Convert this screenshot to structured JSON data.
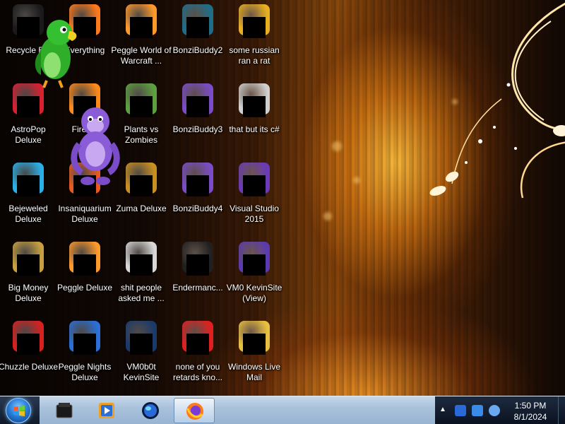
{
  "desktop": {
    "icons": [
      {
        "label": "Recycle Bin",
        "icon": "recycle-bin-icon",
        "color": "#1a1a1a"
      },
      {
        "label": "Everything",
        "icon": "everything-search-icon",
        "color": "#ff7a1a"
      },
      {
        "label": "Peggle World of Warcraft ...",
        "icon": "peggle-wow-icon",
        "color": "#ff9a2a"
      },
      {
        "label": "BonziBuddy2",
        "icon": "bonzibuddy-icon",
        "color": "#1e6e8a"
      },
      {
        "label": "some russian ran a rat",
        "icon": "document-icon",
        "color": "#e8b020"
      },
      {
        "label": "AstroPop Deluxe",
        "icon": "astropop-icon",
        "color": "#d82030"
      },
      {
        "label": "Firefox",
        "icon": "firefox-icon",
        "color": "#ff8a1a"
      },
      {
        "label": "Plants vs Zombies",
        "icon": "plants-vs-zombies-icon",
        "color": "#5ea040"
      },
      {
        "label": "BonziBuddy3",
        "icon": "bonzibuddy-icon",
        "color": "#7a4cc8"
      },
      {
        "label": "that but its c#",
        "icon": "copy-files-icon",
        "color": "#d0d0d0"
      },
      {
        "label": "Bejeweled Deluxe",
        "icon": "bejeweled-icon",
        "color": "#2ab0e8"
      },
      {
        "label": "Insaniquarium Deluxe",
        "icon": "insaniquarium-icon",
        "color": "#e85a20"
      },
      {
        "label": "Zuma Deluxe",
        "icon": "zuma-icon",
        "color": "#c89020"
      },
      {
        "label": "BonziBuddy4",
        "icon": "bonzibuddy-icon",
        "color": "#7a4cc8"
      },
      {
        "label": "Visual Studio 2015",
        "icon": "visual-studio-icon",
        "color": "#6a3ab8"
      },
      {
        "label": "Big Money Deluxe",
        "icon": "big-money-icon",
        "color": "#c8a040"
      },
      {
        "label": "Peggle Deluxe",
        "icon": "peggle-icon",
        "color": "#ff9a2a"
      },
      {
        "label": "shit people asked me ...",
        "icon": "folder-icon",
        "color": "#d8d8d8"
      },
      {
        "label": "Endermanc...",
        "icon": "console-icon",
        "color": "#202020"
      },
      {
        "label": "VM0 KevinSite (View)",
        "icon": "vm-icon",
        "color": "#5a3ab0"
      },
      {
        "label": "Chuzzle Deluxe",
        "icon": "chuzzle-icon",
        "color": "#d82020"
      },
      {
        "label": "Peggle Nights Deluxe",
        "icon": "peggle-nights-icon",
        "color": "#2a70d8"
      },
      {
        "label": "VM0b0t KevinSite",
        "icon": "vm-window-icon",
        "color": "#1a3a6a"
      },
      {
        "label": "none of you retards kno...",
        "icon": "red-circle-icon",
        "color": "#e02020"
      },
      {
        "label": "Windows Live Mail",
        "icon": "mail-icon",
        "color": "#e8c040"
      }
    ]
  },
  "taskbar": {
    "start_label": "Start",
    "pinned": [
      {
        "name": "file-explorer-icon",
        "color": "#1a1a1a"
      },
      {
        "name": "media-player-icon",
        "color": "#f0a020"
      },
      {
        "name": "globe-icon",
        "color": "#2a6ad8"
      },
      {
        "name": "firefox-icon",
        "color": "#ff7a1a"
      }
    ],
    "tray_icons": [
      "network-icon",
      "display-icon",
      "volume-icon"
    ],
    "time": "1:50 PM",
    "date": "8/1/2024"
  },
  "colors": {
    "taskbar": "#a9c2dc",
    "label_text": "#ffffff"
  }
}
